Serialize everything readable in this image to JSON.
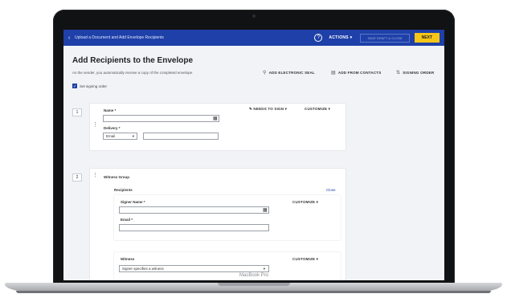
{
  "laptop": {
    "model_label": "MacBook Pro"
  },
  "topbar": {
    "back_icon": "‹",
    "title": "Upload a Document and Add Envelope Recipients",
    "help_icon": "?",
    "actions_label": "ACTIONS ▾",
    "save_label": "SAVE DRAFT & CLOSE",
    "next_label": "NEXT"
  },
  "page": {
    "title": "Add Recipients to the Envelope",
    "subtitle": "As the sender, you automatically receive a copy of the completed envelope.",
    "signing_order_label": "Set signing order",
    "links": {
      "electronic_seal": "ADD ELECTRONIC SEAL",
      "from_contacts": "ADD FROM CONTACTS",
      "signing_order": "SIGNING ORDER"
    }
  },
  "recipient1": {
    "number": "1",
    "name_label": "Name *",
    "name_value": "",
    "delivery_label": "Delivery *",
    "delivery_value": "Email",
    "delivery_detail": "",
    "action_label": "NEEDS TO SIGN ▾",
    "customize_label": "CUSTOMIZE ▾"
  },
  "recipient2": {
    "number": "2",
    "group_label": "Witness Group",
    "recipients_label": "Recipients",
    "close_label": "Close",
    "signer_name_label": "Signer Name *",
    "signer_name_value": "",
    "email_label": "Email *",
    "email_value": "",
    "customize_label": "CUSTOMIZE ▾",
    "witness_label": "Witness",
    "witness_value": "Signer specifies a witness",
    "witness_customize_label": "CUSTOMIZE ▾"
  },
  "colors": {
    "brand": "#1e40a8",
    "accent": "#f5c518"
  }
}
